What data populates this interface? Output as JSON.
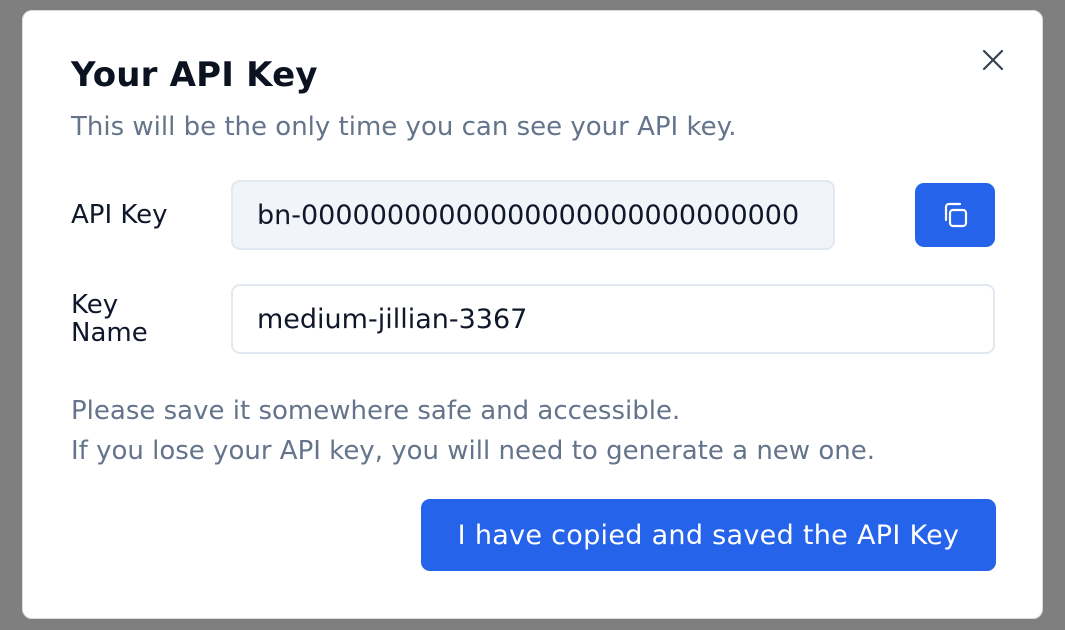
{
  "modal": {
    "title": "Your API Key",
    "subtitle": "This will be the only time you can see your API key.",
    "close_icon": "close-icon",
    "api_key": {
      "label": "API Key",
      "value": "bn-00000000000000000000000000000",
      "copy_icon": "copy-icon"
    },
    "key_name": {
      "label": "Key Name",
      "value": "medium-jillian-3367"
    },
    "note_lines": [
      "Please save it somewhere safe and accessible.",
      "If you lose your API key, you will need to generate a new one."
    ],
    "confirm_label": "I have copied and saved the API Key"
  },
  "colors": {
    "overlay": "#7f7f7f",
    "accent": "#2563eb",
    "muted_text": "#64748b",
    "input_readonly_bg": "#f1f5f9"
  }
}
